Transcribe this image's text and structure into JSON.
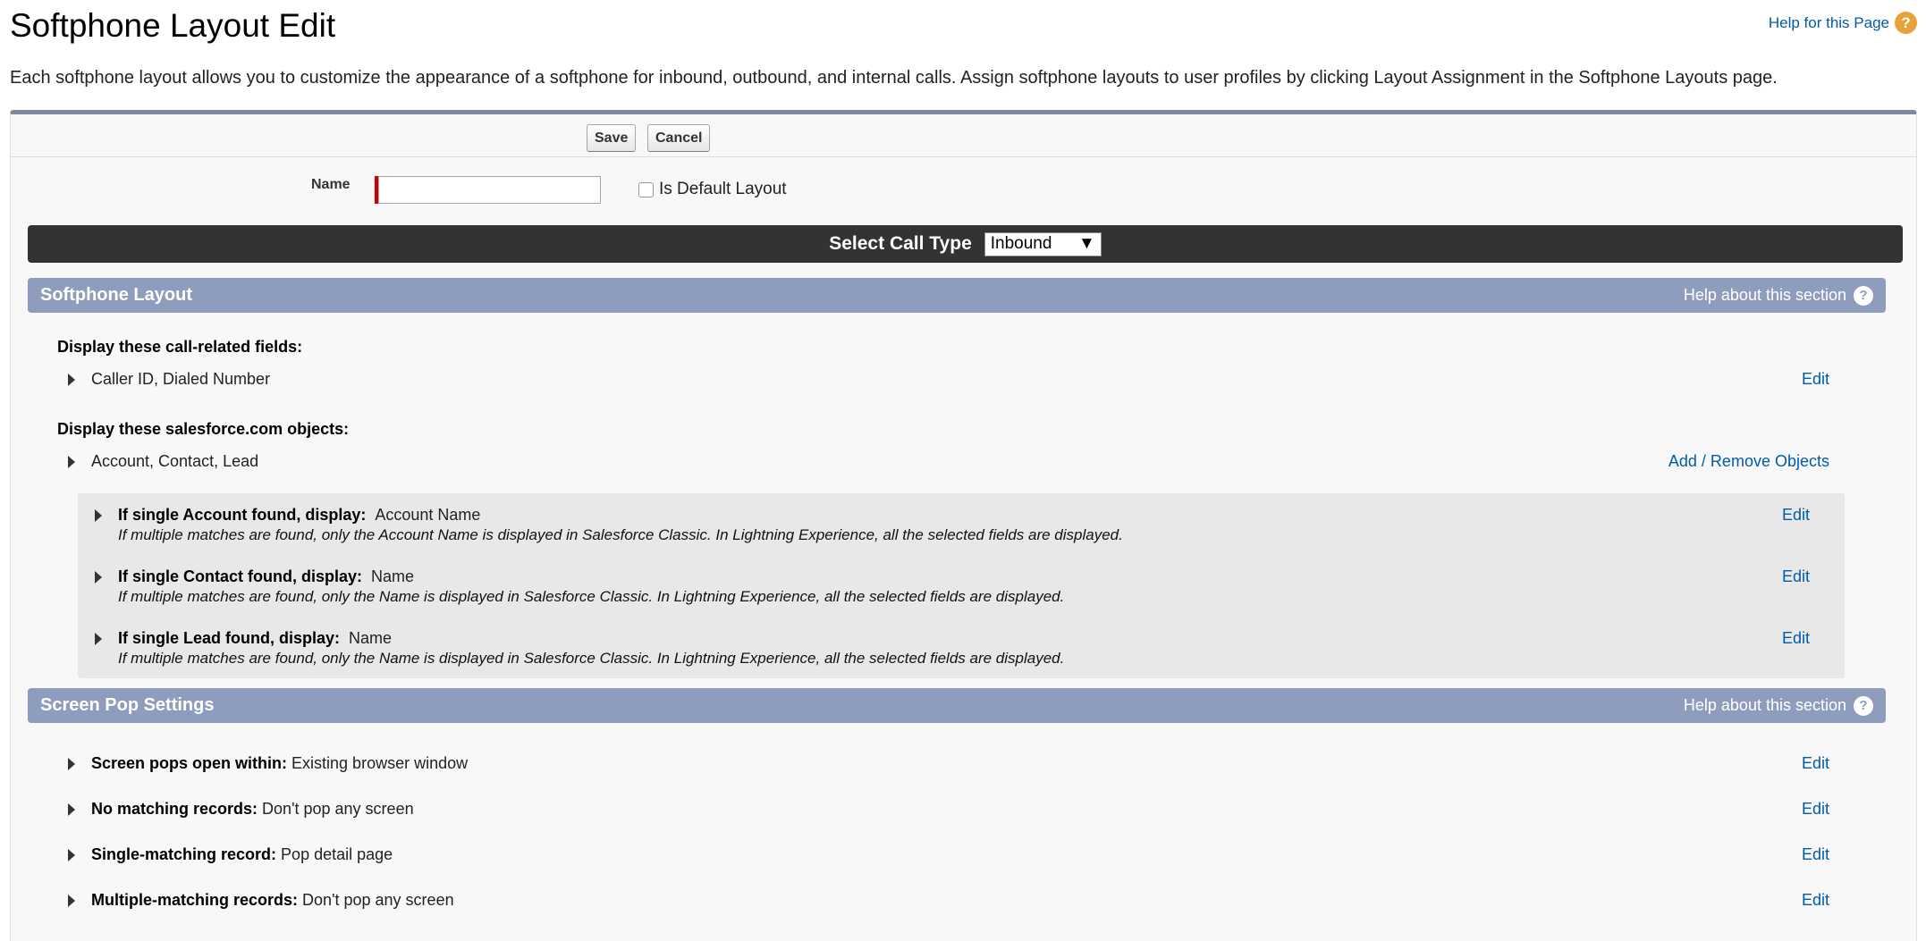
{
  "page": {
    "title": "Softphone Layout Edit",
    "help_link": "Help for this Page",
    "description": "Each softphone layout allows you to customize the appearance of a softphone for inbound, outbound, and internal calls. Assign softphone layouts to user profiles by clicking Layout Assignment in the Softphone Layouts page."
  },
  "toolbar": {
    "save_label": "Save",
    "cancel_label": "Cancel"
  },
  "form": {
    "name_label": "Name",
    "name_value": "",
    "is_default_label": "Is Default Layout",
    "is_default_checked": false
  },
  "call_type": {
    "label": "Select Call Type",
    "selected": "Inbound"
  },
  "softphone_layout": {
    "title": "Softphone Layout",
    "help": "Help about this section",
    "call_fields_heading": "Display these call-related fields:",
    "call_fields_value": "Caller ID, Dialed Number",
    "call_fields_edit": "Edit",
    "objects_heading": "Display these salesforce.com objects:",
    "objects_value": "Account, Contact, Lead",
    "objects_action": "Add / Remove Objects",
    "objects": [
      {
        "label": "If single Account found, display:",
        "value": "Account Name",
        "note": "If multiple matches are found, only the Account Name is displayed in Salesforce Classic. In Lightning Experience, all the selected fields are displayed.",
        "edit": "Edit"
      },
      {
        "label": "If single Contact found, display:",
        "value": "Name",
        "note": "If multiple matches are found, only the Name is displayed in Salesforce Classic. In Lightning Experience, all the selected fields are displayed.",
        "edit": "Edit"
      },
      {
        "label": "If single Lead found, display:",
        "value": "Name",
        "note": "If multiple matches are found, only the Name is displayed in Salesforce Classic. In Lightning Experience, all the selected fields are displayed.",
        "edit": "Edit"
      }
    ]
  },
  "screen_pop": {
    "title": "Screen Pop Settings",
    "help": "Help about this section",
    "items": [
      {
        "label": "Screen pops open within:",
        "value": "Existing browser window",
        "edit": "Edit"
      },
      {
        "label": "No matching records:",
        "value": "Don't pop any screen",
        "edit": "Edit"
      },
      {
        "label": "Single-matching record:",
        "value": "Pop detail page",
        "edit": "Edit"
      },
      {
        "label": "Multiple-matching records:",
        "value": "Don't pop any screen",
        "edit": "Edit"
      }
    ]
  },
  "colors": {
    "section_header": "#8e9dbe",
    "call_type_bar": "#333333",
    "link": "#015ba7",
    "required": "#cc0000"
  },
  "icons": [
    "help-orange-icon",
    "help-white-icon",
    "expand-triangle-icon",
    "dropdown-arrow-icon",
    "checkbox-icon"
  ]
}
